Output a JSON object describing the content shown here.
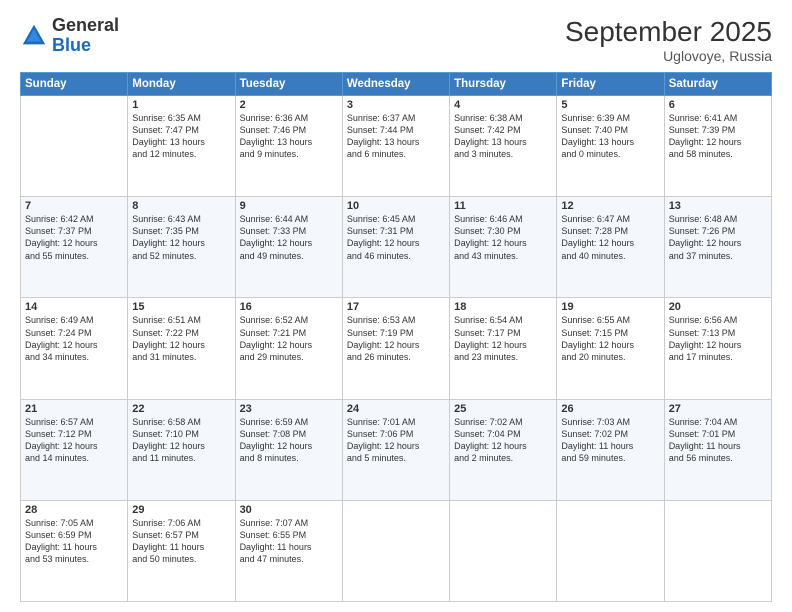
{
  "header": {
    "logo_general": "General",
    "logo_blue": "Blue",
    "month": "September 2025",
    "location": "Uglovoye, Russia"
  },
  "days_of_week": [
    "Sunday",
    "Monday",
    "Tuesday",
    "Wednesday",
    "Thursday",
    "Friday",
    "Saturday"
  ],
  "weeks": [
    [
      {
        "day": "",
        "info": ""
      },
      {
        "day": "1",
        "info": "Sunrise: 6:35 AM\nSunset: 7:47 PM\nDaylight: 13 hours\nand 12 minutes."
      },
      {
        "day": "2",
        "info": "Sunrise: 6:36 AM\nSunset: 7:46 PM\nDaylight: 13 hours\nand 9 minutes."
      },
      {
        "day": "3",
        "info": "Sunrise: 6:37 AM\nSunset: 7:44 PM\nDaylight: 13 hours\nand 6 minutes."
      },
      {
        "day": "4",
        "info": "Sunrise: 6:38 AM\nSunset: 7:42 PM\nDaylight: 13 hours\nand 3 minutes."
      },
      {
        "day": "5",
        "info": "Sunrise: 6:39 AM\nSunset: 7:40 PM\nDaylight: 13 hours\nand 0 minutes."
      },
      {
        "day": "6",
        "info": "Sunrise: 6:41 AM\nSunset: 7:39 PM\nDaylight: 12 hours\nand 58 minutes."
      }
    ],
    [
      {
        "day": "7",
        "info": "Sunrise: 6:42 AM\nSunset: 7:37 PM\nDaylight: 12 hours\nand 55 minutes."
      },
      {
        "day": "8",
        "info": "Sunrise: 6:43 AM\nSunset: 7:35 PM\nDaylight: 12 hours\nand 52 minutes."
      },
      {
        "day": "9",
        "info": "Sunrise: 6:44 AM\nSunset: 7:33 PM\nDaylight: 12 hours\nand 49 minutes."
      },
      {
        "day": "10",
        "info": "Sunrise: 6:45 AM\nSunset: 7:31 PM\nDaylight: 12 hours\nand 46 minutes."
      },
      {
        "day": "11",
        "info": "Sunrise: 6:46 AM\nSunset: 7:30 PM\nDaylight: 12 hours\nand 43 minutes."
      },
      {
        "day": "12",
        "info": "Sunrise: 6:47 AM\nSunset: 7:28 PM\nDaylight: 12 hours\nand 40 minutes."
      },
      {
        "day": "13",
        "info": "Sunrise: 6:48 AM\nSunset: 7:26 PM\nDaylight: 12 hours\nand 37 minutes."
      }
    ],
    [
      {
        "day": "14",
        "info": "Sunrise: 6:49 AM\nSunset: 7:24 PM\nDaylight: 12 hours\nand 34 minutes."
      },
      {
        "day": "15",
        "info": "Sunrise: 6:51 AM\nSunset: 7:22 PM\nDaylight: 12 hours\nand 31 minutes."
      },
      {
        "day": "16",
        "info": "Sunrise: 6:52 AM\nSunset: 7:21 PM\nDaylight: 12 hours\nand 29 minutes."
      },
      {
        "day": "17",
        "info": "Sunrise: 6:53 AM\nSunset: 7:19 PM\nDaylight: 12 hours\nand 26 minutes."
      },
      {
        "day": "18",
        "info": "Sunrise: 6:54 AM\nSunset: 7:17 PM\nDaylight: 12 hours\nand 23 minutes."
      },
      {
        "day": "19",
        "info": "Sunrise: 6:55 AM\nSunset: 7:15 PM\nDaylight: 12 hours\nand 20 minutes."
      },
      {
        "day": "20",
        "info": "Sunrise: 6:56 AM\nSunset: 7:13 PM\nDaylight: 12 hours\nand 17 minutes."
      }
    ],
    [
      {
        "day": "21",
        "info": "Sunrise: 6:57 AM\nSunset: 7:12 PM\nDaylight: 12 hours\nand 14 minutes."
      },
      {
        "day": "22",
        "info": "Sunrise: 6:58 AM\nSunset: 7:10 PM\nDaylight: 12 hours\nand 11 minutes."
      },
      {
        "day": "23",
        "info": "Sunrise: 6:59 AM\nSunset: 7:08 PM\nDaylight: 12 hours\nand 8 minutes."
      },
      {
        "day": "24",
        "info": "Sunrise: 7:01 AM\nSunset: 7:06 PM\nDaylight: 12 hours\nand 5 minutes."
      },
      {
        "day": "25",
        "info": "Sunrise: 7:02 AM\nSunset: 7:04 PM\nDaylight: 12 hours\nand 2 minutes."
      },
      {
        "day": "26",
        "info": "Sunrise: 7:03 AM\nSunset: 7:02 PM\nDaylight: 11 hours\nand 59 minutes."
      },
      {
        "day": "27",
        "info": "Sunrise: 7:04 AM\nSunset: 7:01 PM\nDaylight: 11 hours\nand 56 minutes."
      }
    ],
    [
      {
        "day": "28",
        "info": "Sunrise: 7:05 AM\nSunset: 6:59 PM\nDaylight: 11 hours\nand 53 minutes."
      },
      {
        "day": "29",
        "info": "Sunrise: 7:06 AM\nSunset: 6:57 PM\nDaylight: 11 hours\nand 50 minutes."
      },
      {
        "day": "30",
        "info": "Sunrise: 7:07 AM\nSunset: 6:55 PM\nDaylight: 11 hours\nand 47 minutes."
      },
      {
        "day": "",
        "info": ""
      },
      {
        "day": "",
        "info": ""
      },
      {
        "day": "",
        "info": ""
      },
      {
        "day": "",
        "info": ""
      }
    ]
  ]
}
